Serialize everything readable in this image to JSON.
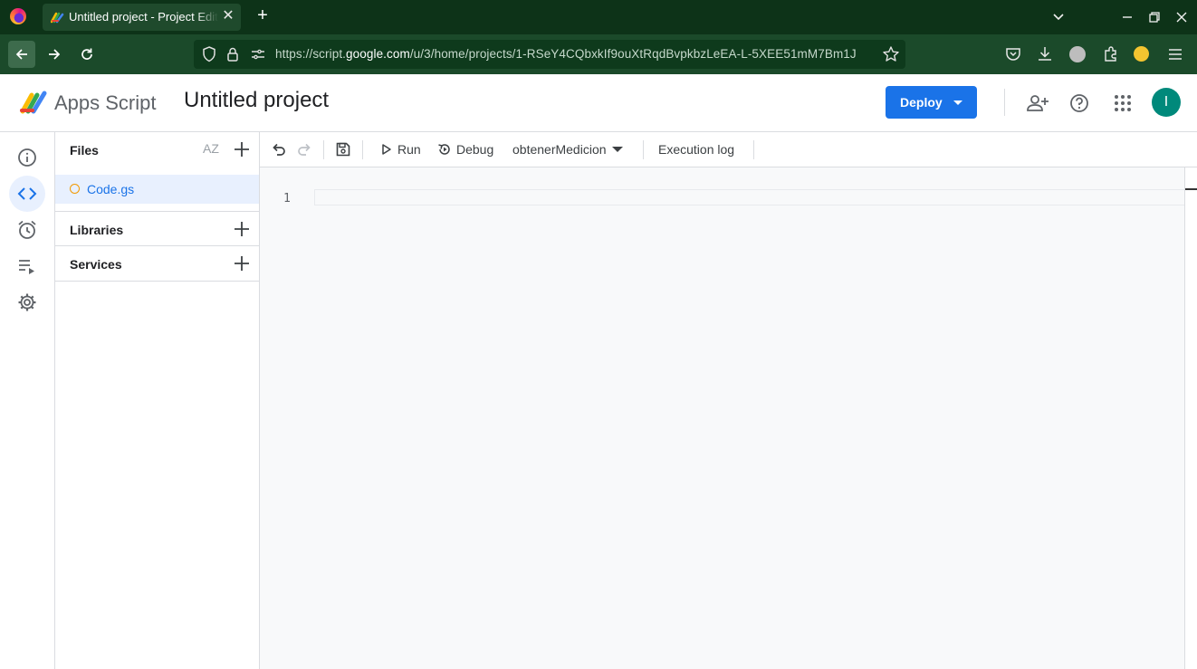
{
  "browser": {
    "tab_title": "Untitled project - Project Editor - Apps Script",
    "url_prefix": "https://script.",
    "url_domain": "google.com",
    "url_path": "/u/3/home/projects/1-RSeY4CQbxkIf9ouXtRqdBvpkbzLeEA-L-5XEE51mM7Bm1J"
  },
  "header": {
    "app_name": "Apps Script",
    "project_title": "Untitled project",
    "deploy_label": "Deploy",
    "avatar_initial": "I"
  },
  "files_panel": {
    "files_label": "Files",
    "sort_label": "AZ",
    "file": {
      "name": "Code.gs"
    },
    "libraries_label": "Libraries",
    "services_label": "Services"
  },
  "toolbar": {
    "run_label": "Run",
    "debug_label": "Debug",
    "function_selected": "obtenerMedicion",
    "execution_log_label": "Execution log"
  },
  "editor": {
    "line_numbers": [
      "1"
    ]
  },
  "colors": {
    "browser_tabbar": "#0d3318",
    "browser_navbar": "#1b4a2a",
    "accent": "#1a73e8",
    "avatar": "#00897b",
    "selected_bg": "#e8f0fe"
  }
}
